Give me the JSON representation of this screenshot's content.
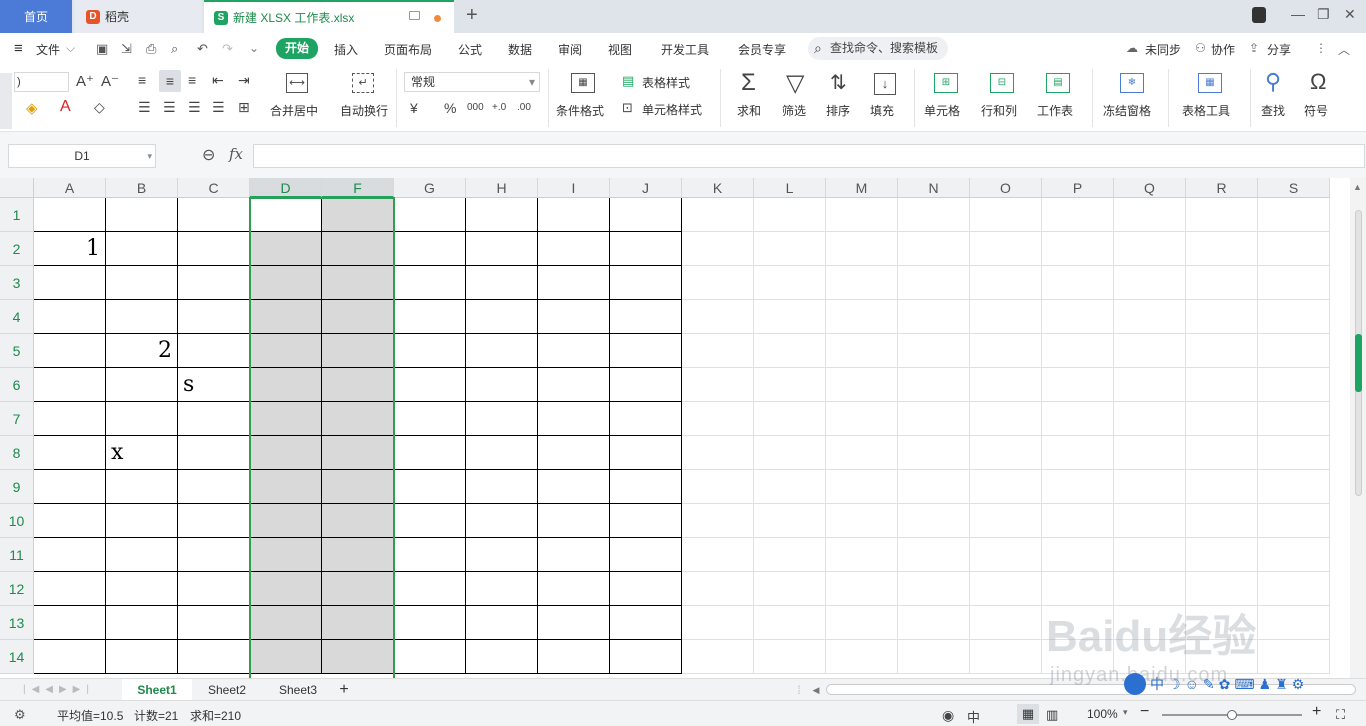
{
  "titlebar": {
    "tabs": [
      {
        "label": "首页"
      },
      {
        "label": "稻壳",
        "badge": "D"
      },
      {
        "label": "新建 XLSX 工作表.xlsx",
        "badge": "S"
      }
    ],
    "new_tab_glyph": "+",
    "window_controls": [
      "—",
      "❐",
      "✕"
    ]
  },
  "menubar": {
    "file_label": "文件",
    "items": [
      "开始",
      "插入",
      "页面布局",
      "公式",
      "数据",
      "审阅",
      "视图",
      "开发工具",
      "会员专享"
    ],
    "search_placeholder": "查找命令、搜索模板",
    "right_items": [
      "未同步",
      "协作",
      "分享"
    ]
  },
  "ribbon": {
    "merge_center": "合并居中",
    "wrap_text": "自动换行",
    "number_format": "常规",
    "currency_glyph": "¥",
    "percent_glyph": "%",
    "thousands_glyph": "000",
    "dec_inc_glyph": "+.0",
    "dec_dec_glyph": ".00",
    "cond_format": "条件格式",
    "table_style": "表格样式",
    "cell_style": "单元格样式",
    "sum": "求和",
    "filter": "筛选",
    "sort": "排序",
    "fill": "填充",
    "cell": "单元格",
    "row_col": "行和列",
    "worksheet": "工作表",
    "freeze": "冻结窗格",
    "table_tools": "表格工具",
    "find": "查找",
    "symbol": "符号"
  },
  "formula_bar": {
    "name_box": "D1",
    "fx_label": "fx",
    "content": ""
  },
  "grid": {
    "columns": [
      "A",
      "B",
      "C",
      "D",
      "F",
      "G",
      "H",
      "I",
      "J",
      "K",
      "L",
      "M",
      "N",
      "O",
      "P",
      "Q",
      "R",
      "S"
    ],
    "selected_columns": [
      "D",
      "F"
    ],
    "rows": [
      "1",
      "2",
      "3",
      "4",
      "5",
      "6",
      "7",
      "8",
      "9",
      "10",
      "11",
      "12",
      "13",
      "14"
    ],
    "cells": {
      "A2": "1",
      "B5": "2",
      "C6": "s",
      "B8": "x"
    }
  },
  "sheets": {
    "tabs": [
      "Sheet1",
      "Sheet2",
      "Sheet3"
    ],
    "active": "Sheet1",
    "add_glyph": "+"
  },
  "status": {
    "average": "平均值=10.5",
    "count": "计数=21",
    "sum": "求和=210",
    "zoom": "100%",
    "zoom_level": 1.0
  },
  "watermark": {
    "text": "Baidu经验",
    "subtext": "jingyan.baidu.com"
  },
  "colors": {
    "accent": "#1da462",
    "home_tab": "#4b7bd6",
    "selection": "#d9d9d9"
  }
}
